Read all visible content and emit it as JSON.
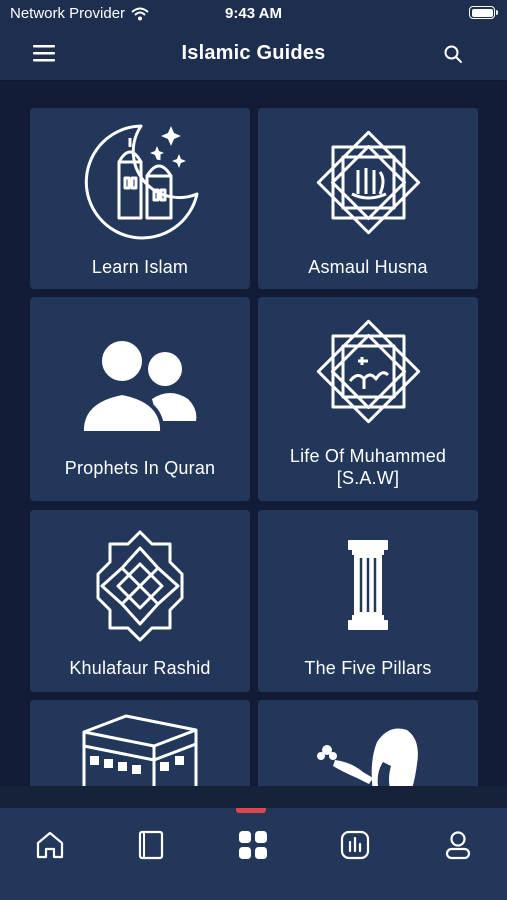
{
  "status_bar": {
    "carrier": "Network Provider",
    "time": "9:43 AM"
  },
  "header": {
    "title": "Islamic Guides"
  },
  "cards": [
    {
      "label": "Learn Islam",
      "icon": "crescent-mosque-icon"
    },
    {
      "label": "Asmaul Husna",
      "icon": "allah-calligraphy-icon"
    },
    {
      "label": "Prophets In Quran",
      "icon": "people-icon"
    },
    {
      "label": "Life Of Muhammed [S.A.W]",
      "icon": "muhammad-calligraphy-icon"
    },
    {
      "label": "Khulafaur Rashid",
      "icon": "geometric-star-icon"
    },
    {
      "label": "The Five Pillars",
      "icon": "pillar-icon"
    },
    {
      "label": "",
      "icon": "kaaba-icon"
    },
    {
      "label": "",
      "icon": "praying-woman-icon"
    }
  ],
  "bottom_nav": {
    "items": [
      "home-icon",
      "quran-book-icon",
      "grid-icon",
      "stats-icon",
      "profile-icon"
    ],
    "active": "grid-icon"
  }
}
